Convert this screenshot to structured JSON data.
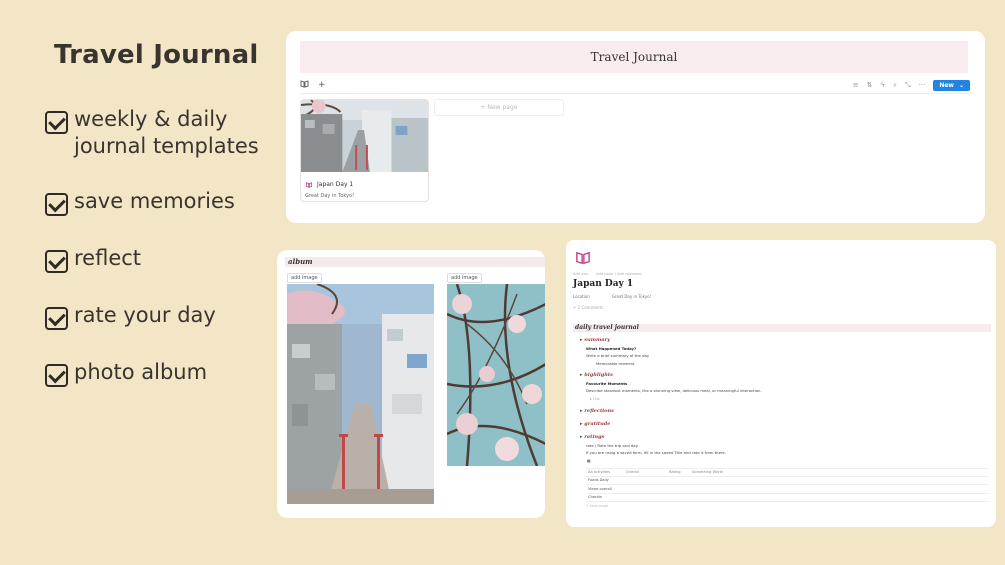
{
  "left": {
    "title": "Travel Journal",
    "features": [
      {
        "line1": "weekly & daily",
        "line2": "journal templates"
      },
      {
        "line1": "save memories",
        "line2": ""
      },
      {
        "line1": "reflect",
        "line2": ""
      },
      {
        "line1": "rate your day",
        "line2": ""
      },
      {
        "line1": "photo album",
        "line2": ""
      }
    ]
  },
  "database": {
    "banner_title": "Travel Journal",
    "toolbar": {
      "view_icon": "book-icon",
      "add": "+",
      "new_label": "New",
      "dropdown": "⌄"
    },
    "entry": {
      "title": "Japan Day 1",
      "subtitle": "Great Day in Tokyo!"
    },
    "new_page_label": "+  New page"
  },
  "album": {
    "heading": "album",
    "add_image_label": "add image"
  },
  "page": {
    "icon": "book-icon",
    "meta_icon": "Add icon",
    "meta_cover": "Add cover / Add comment",
    "title": "Japan Day 1",
    "property_name": "Location",
    "property_value": "Great Day in Tokyo!",
    "comments": "+ 2 Comments",
    "section": "daily travel journal",
    "summary": {
      "label": "summary",
      "heading": "What Happened Today?",
      "text": "Write a brief summary of the day",
      "bullet": "Memorable moment"
    },
    "highlights": {
      "label": "highlights",
      "heading": "Favourite Moments",
      "text": "Describe standout moments, like a stunning view, delicious meal, or meaningful interaction.",
      "more": "▸  List"
    },
    "reflections": {
      "label": "reflections"
    },
    "gratitude": {
      "label": "gratitude"
    },
    "ratings": {
      "label": "ratings",
      "line1": "rate / Rate the trip and day.",
      "line2": "If you are using a saved form, fill in the saved Title and rate it from there.",
      "table_icon": "table-icon",
      "columns": [
        "Aa activities",
        "Overall",
        "Rating",
        "Something Worth"
      ],
      "rows": [
        {
          "name": "Foods Daily"
        },
        {
          "name": "Views overall"
        },
        {
          "name": "Checkin"
        }
      ],
      "new_page": "+ New page"
    }
  }
}
